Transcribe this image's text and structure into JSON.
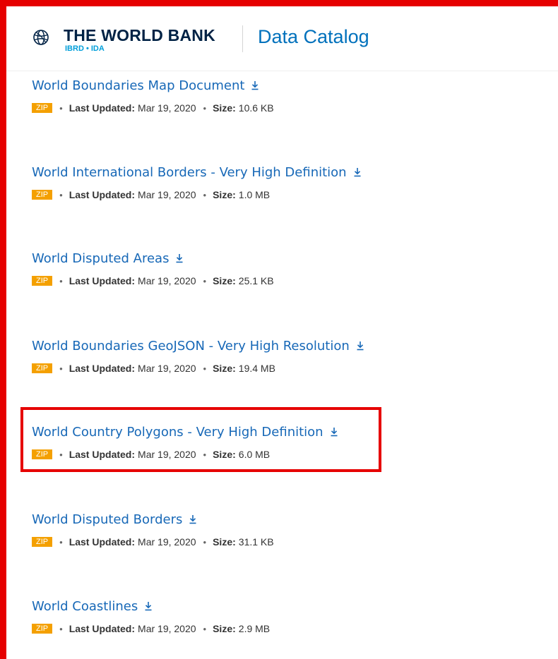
{
  "header": {
    "brand_name": "THE WORLD BANK",
    "brand_sub": "IBRD • IDA",
    "catalog_title": "Data Catalog",
    "globe_icon": "globe-icon"
  },
  "colors": {
    "annotation_red": "#e60000",
    "link_blue": "#1768b7",
    "badge_orange": "#f4a000",
    "brand_navy": "#002245",
    "accent_blue": "#009fda"
  },
  "items": [
    {
      "title": "World Boundaries Map Document",
      "format": "ZIP",
      "updated_label": "Last Updated:",
      "updated": "Mar 19, 2020",
      "size_label": "Size:",
      "size": "10.6 KB"
    },
    {
      "title": "World International Borders - Very High Definition",
      "format": "ZIP",
      "updated_label": "Last Updated:",
      "updated": "Mar 19, 2020",
      "size_label": "Size:",
      "size": "1.0 MB"
    },
    {
      "title": "World Disputed Areas",
      "format": "ZIP",
      "updated_label": "Last Updated:",
      "updated": "Mar 19, 2020",
      "size_label": "Size:",
      "size": "25.1 KB"
    },
    {
      "title": "World Boundaries GeoJSON - Very High Resolution",
      "format": "ZIP",
      "updated_label": "Last Updated:",
      "updated": "Mar 19, 2020",
      "size_label": "Size:",
      "size": "19.4 MB"
    },
    {
      "title": "World Country Polygons - Very High Definition",
      "format": "ZIP",
      "updated_label": "Last Updated:",
      "updated": "Mar 19, 2020",
      "size_label": "Size:",
      "size": "6.0 MB"
    },
    {
      "title": "World Disputed Borders",
      "format": "ZIP",
      "updated_label": "Last Updated:",
      "updated": "Mar 19, 2020",
      "size_label": "Size:",
      "size": "31.1 KB"
    },
    {
      "title": "World Coastlines",
      "format": "ZIP",
      "updated_label": "Last Updated:",
      "updated": "Mar 19, 2020",
      "size_label": "Size:",
      "size": "2.9 MB"
    }
  ]
}
